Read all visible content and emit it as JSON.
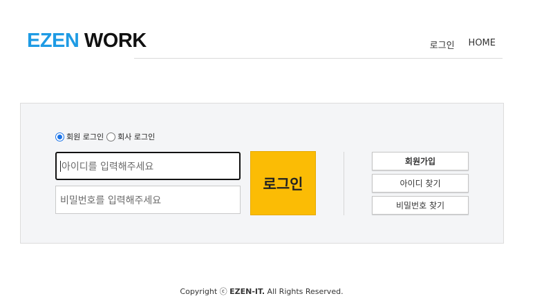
{
  "header": {
    "logo_part1": "EZEN",
    "logo_part2": "WORK",
    "nav": {
      "login": "로그인",
      "home": "HOME"
    }
  },
  "login": {
    "member_types": [
      {
        "label": "회원 로그인",
        "checked": true
      },
      {
        "label": "회사 로그인",
        "checked": false
      }
    ],
    "id_placeholder": "아이디를 입력해주세요",
    "pw_placeholder": "비밀번호를 입력해주세요",
    "submit_label": "로그인"
  },
  "side": {
    "join": "회원가입",
    "find_id": "아이디 찾기",
    "find_pw": "비밀번호 찾기"
  },
  "footer": {
    "prefix": "Copyright ⓒ",
    "brand": "EZEN-IT.",
    "suffix": "All Rights Reserved."
  },
  "colors": {
    "logo_accent": "#1e9be4",
    "login_button": "#fbbc05",
    "panel_bg": "#f4f5f7",
    "radio_selected": "#1a73e8"
  }
}
